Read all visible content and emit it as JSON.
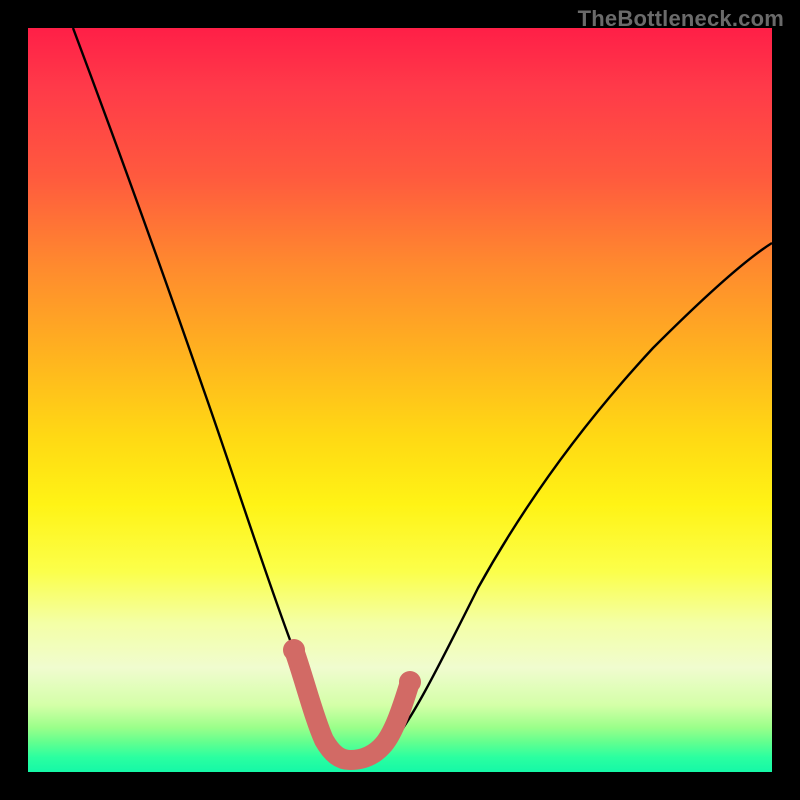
{
  "branding": {
    "text": "TheBottleneck.com"
  },
  "chart_data": {
    "type": "line",
    "title": "",
    "xlabel": "",
    "ylabel": "",
    "xlim": [
      0,
      100
    ],
    "ylim": [
      0,
      100
    ],
    "series": [
      {
        "name": "curve",
        "x": [
          6,
          10,
          15,
          20,
          25,
          30,
          33,
          36,
          38,
          40,
          42,
          44,
          46,
          50,
          55,
          60,
          65,
          70,
          75,
          80,
          85,
          90,
          95,
          100
        ],
        "values": [
          100,
          88,
          74,
          62,
          51,
          38,
          28,
          18,
          10,
          5,
          3,
          3,
          4,
          8,
          15,
          23,
          30,
          37,
          43,
          49,
          55,
          60,
          64,
          68
        ]
      },
      {
        "name": "highlight-band",
        "x": [
          36,
          38,
          40,
          42,
          44,
          46,
          48
        ],
        "values": [
          14,
          9,
          5,
          3,
          3,
          5,
          9
        ]
      }
    ],
    "colors": {
      "curve": "#000000",
      "highlight": "#d26a65",
      "gradient_top": "#ff1f47",
      "gradient_bottom": "#15f8a7"
    }
  }
}
